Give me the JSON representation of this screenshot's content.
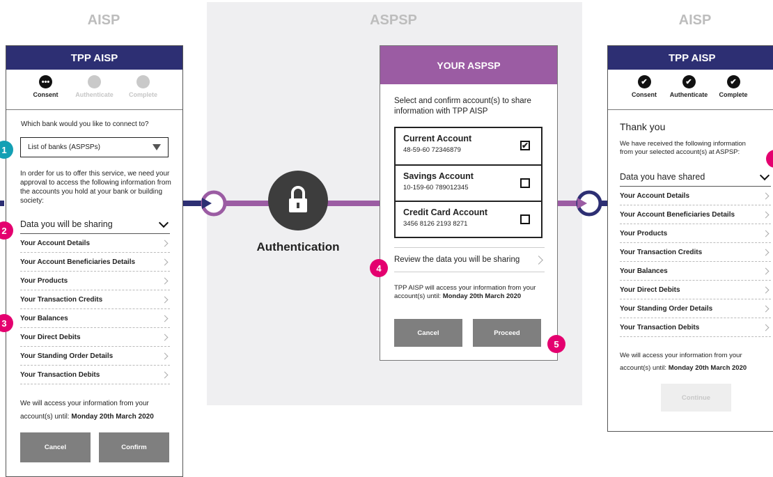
{
  "section_titles": {
    "left": "AISP",
    "middle": "ASPSP",
    "right": "AISP"
  },
  "left_phone": {
    "header": "TPP AISP",
    "steps": [
      {
        "label": "Consent",
        "state": "active"
      },
      {
        "label": "Authenticate",
        "state": "pending"
      },
      {
        "label": "Complete",
        "state": "pending"
      }
    ],
    "question": "Which bank would you like to connect to?",
    "dropdown_value": "List of banks (ASPSPs)",
    "intro": "In order for us to offer this service, we need your approval to access the following information from the accounts you hold at your bank or building society:",
    "sharing_heading": "Data you will be sharing",
    "items": [
      "Your Account Details",
      "Your Account Beneficiaries Details",
      "Your Products",
      "Your Transaction Credits",
      "Your Balances",
      "Your Direct Debits",
      "Your Standing Order Details",
      "Your Transaction Debits"
    ],
    "access_text": "We will access your information from your account(s) until:",
    "access_date": "Monday 20th March 2020",
    "cancel_label": "Cancel",
    "confirm_label": "Confirm"
  },
  "auth": {
    "label": "Authentication",
    "icon": "lock-icon"
  },
  "aspsp_phone": {
    "header": "YOUR ASPSP",
    "instruction": "Select and confirm account(s) to share information with TPP AISP",
    "accounts": [
      {
        "name": "Current Account",
        "number": "48-59-60  72346879",
        "checked": "✔"
      },
      {
        "name": "Savings Account",
        "number": "10-159-60  789012345",
        "checked": ""
      },
      {
        "name": "Credit Card Account",
        "number": "3456 8126 2193 8271",
        "checked": ""
      }
    ],
    "review_label": "Review the data you will be sharing",
    "access_text": "TPP AISP will access your information from your account(s) until:",
    "access_date": "Monday 20th March 2020",
    "cancel_label": "Cancel",
    "proceed_label": "Proceed"
  },
  "right_phone": {
    "header": "TPP AISP",
    "steps": [
      {
        "label": "Consent",
        "state": "done"
      },
      {
        "label": "Authenticate",
        "state": "done"
      },
      {
        "label": "Complete",
        "state": "done"
      }
    ],
    "thank_you": "Thank you",
    "received_text": "We have received the following information from your selected account(s) at ASPSP:",
    "shared_heading": "Data you have shared",
    "items": [
      "Your Account Details",
      "Your Account Beneficiaries Details",
      "Your Products",
      "Your Transaction Credits",
      "Your Balances",
      "Your Direct Debits",
      "Your Standing Order Details",
      "Your Transaction Debits"
    ],
    "access_text": "We will access your information from your account(s) until:",
    "access_date": "Monday 20th March 2020",
    "continue_label": "Continue"
  },
  "badges": [
    "1",
    "2",
    "3",
    "4",
    "5"
  ],
  "colors": {
    "navy": "#2d2f73",
    "purple": "#9b5ca3",
    "pink": "#e4006f",
    "teal": "#14a0b4"
  }
}
